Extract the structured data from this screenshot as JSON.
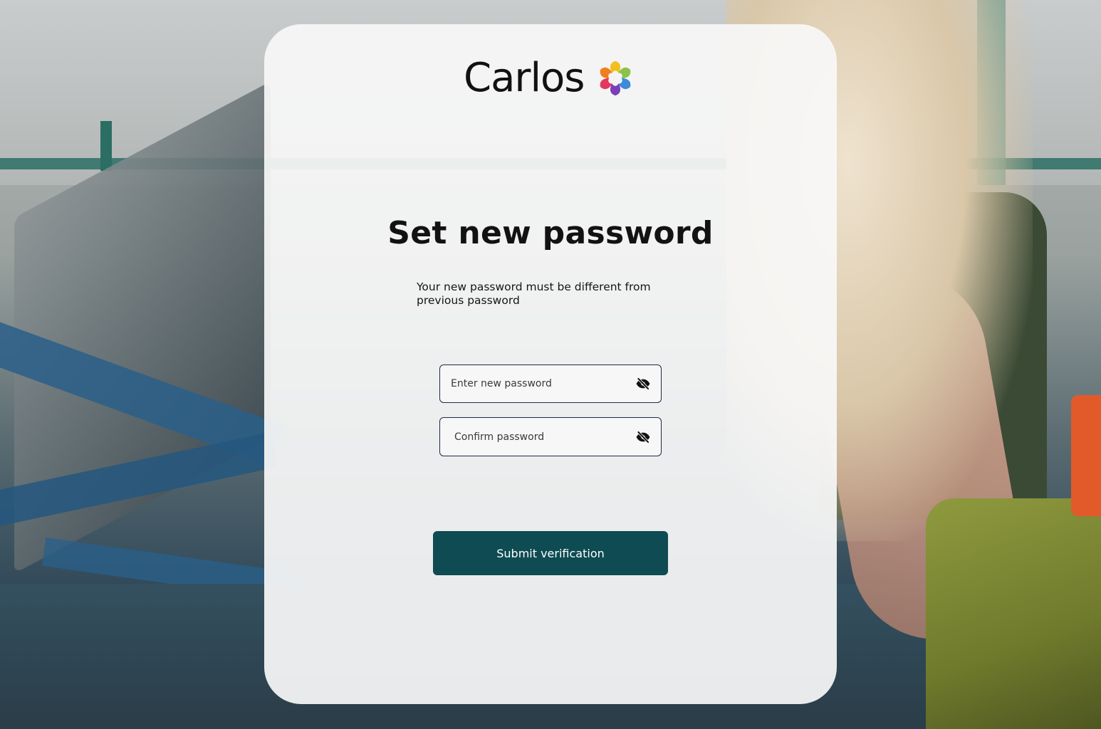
{
  "brand": {
    "name": "Carlos",
    "logo_icon": "flower-petals-icon",
    "petal_colors": [
      "#f2c01d",
      "#8bc34a",
      "#3d8bd9",
      "#7a3fb8",
      "#e2385d",
      "#f07f1e"
    ]
  },
  "page": {
    "title": "Set new password",
    "subtitle": "Your new password must be different from previous password"
  },
  "form": {
    "new_password": {
      "placeholder": "Enter new password",
      "value": "",
      "toggle_icon": "eye-off-icon"
    },
    "confirm_password": {
      "placeholder": "Confirm password",
      "value": "",
      "toggle_icon": "eye-off-icon"
    },
    "submit_label": "Submit verification"
  },
  "colors": {
    "primary": "#0e4b52",
    "input_border": "#1f2a44",
    "card_bg": "#f8f8f8"
  }
}
